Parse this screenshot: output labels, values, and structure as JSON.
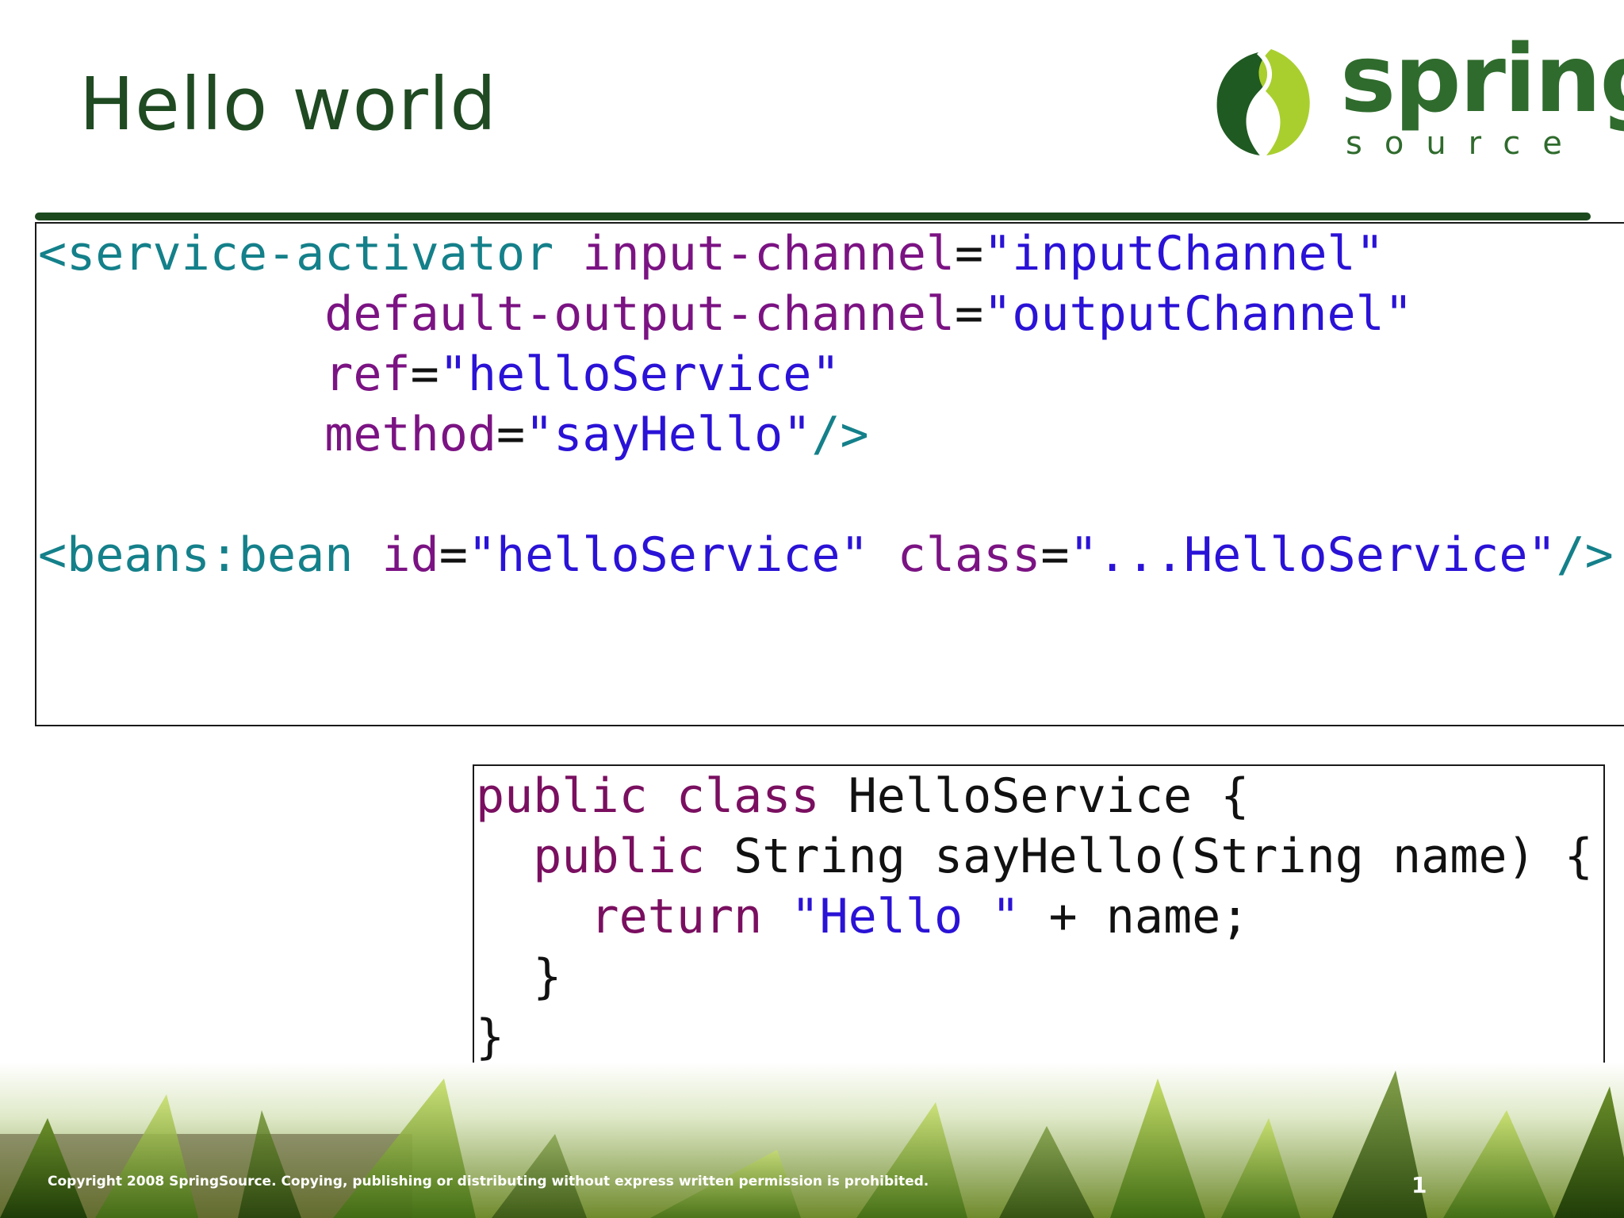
{
  "slide": {
    "title": "Hello world",
    "copyright": "Copyright 2008 SpringSource.  Copying, publishing or distributing without express written permission is prohibited.",
    "page_number": "1"
  },
  "logo": {
    "word": "spring",
    "sub": "source",
    "colors": {
      "dark_green": "#2f6b2d",
      "leaf_dark": "#1f5a22",
      "leaf_light": "#a9cf2f"
    }
  },
  "xml": {
    "line1": {
      "tag": "<service-activator",
      "attr": "input-channel",
      "eq": "=",
      "val": "\"inputChannel\""
    },
    "line2": {
      "attr": "default-output-channel",
      "eq": "=",
      "val": "\"outputChannel\""
    },
    "line3": {
      "attr": "ref",
      "eq": "=",
      "val": "\"helloService\""
    },
    "line4": {
      "attr": "method",
      "eq": "=",
      "val": "\"sayHello\"",
      "close": "/>"
    },
    "line6": {
      "tag": "<beans:bean",
      "attr1": "id",
      "eq1": "=",
      "val1": "\"helloService\"",
      "attr2": "class",
      "eq2": "=",
      "val2": "\"...HelloService\"",
      "close": "/>"
    }
  },
  "java": {
    "line1": {
      "kw": "public class",
      "rest": " HelloService {"
    },
    "line2": {
      "kw": "public",
      "rest": " String sayHello(String name) {"
    },
    "line3": {
      "kw": "return",
      "str": "\"Hello \"",
      "rest": " + name;"
    },
    "line4": {
      "rest": "}"
    },
    "line5": {
      "rest": "}"
    }
  },
  "theme": {
    "title_color": "#1f4a22",
    "rule_color": "#1c4a1e",
    "tag_color": "#14808a",
    "attr_color": "#7b1383",
    "string_color": "#2a12d6",
    "keyword_color": "#7a0f60"
  }
}
